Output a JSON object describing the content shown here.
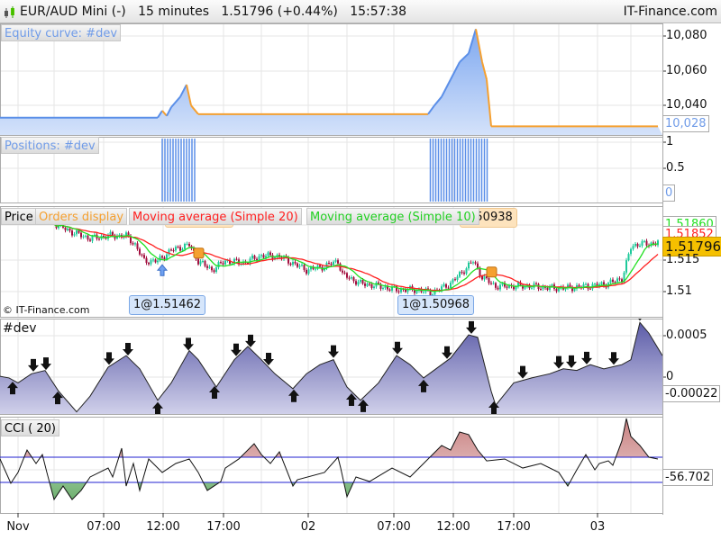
{
  "header": {
    "title": "EUR/AUD Mini (-)   15 minutes   1.51796 (+0.44%)   15:57:38",
    "brand": "IT-Finance.com"
  },
  "panels": {
    "equity": {
      "label": "Equity curve: #dev",
      "axis": [
        "10,080",
        "10,060",
        "10,040"
      ],
      "current": "10,028"
    },
    "positions": {
      "label": "Positions: #dev",
      "axis": [
        "1",
        "0.5"
      ],
      "current": "0"
    },
    "price": {
      "legend": [
        "Price",
        "Orders display",
        "Moving average (Simple 20)",
        "Moving average (Simple 10)"
      ],
      "axis": [
        "1.515",
        "1.51"
      ],
      "ma10_value": "1.51860",
      "ma20_value": "1.51852",
      "current": "1.51796",
      "orders": [
        "1@1.51462",
        "1@1.50968",
        "1.50938"
      ],
      "copyright": "© IT-Finance.com"
    },
    "dev": {
      "label": "#dev",
      "axis": [
        "0.0005",
        "0"
      ],
      "current": "-0.00022"
    },
    "cci": {
      "label": "CCI ( 20)",
      "current": "-56.702"
    }
  },
  "xaxis": {
    "ticks": [
      "Nov",
      "07:00",
      "12:00",
      "17:00",
      "02",
      "07:00",
      "12:00",
      "17:00",
      "03"
    ]
  },
  "colors": {
    "up": "#1ec99a",
    "down": "#a3103f",
    "ma20": "#ff2020",
    "ma10": "#22e022",
    "equity_up": "#5b8fe8",
    "equity_down": "#f5a030",
    "current": "#f5c000"
  },
  "chart_data": [
    {
      "type": "area",
      "name": "equity",
      "points": [
        [
          0,
          10033
        ],
        [
          70,
          10033
        ],
        [
          72,
          10037
        ],
        [
          74,
          10034
        ],
        [
          76,
          10039
        ],
        [
          80,
          10045
        ],
        [
          82.8,
          10052
        ],
        [
          84.8,
          10040
        ],
        [
          88,
          10035
        ],
        [
          190,
          10035
        ],
        [
          192.8,
          10040
        ],
        [
          196,
          10045
        ],
        [
          200,
          10055
        ],
        [
          204,
          10065
        ],
        [
          208,
          10070
        ],
        [
          211.2,
          10084
        ],
        [
          214,
          10065
        ],
        [
          216,
          10055
        ],
        [
          218,
          10028
        ],
        [
          292,
          10028
        ]
      ]
    },
    {
      "type": "bar",
      "name": "positions",
      "ranges": [
        [
          72,
          87
        ],
        [
          191,
          217
        ]
      ],
      "value": 1
    },
    {
      "type": "candlestick",
      "name": "price",
      "closes": [
        [
          24,
          1.52086
        ],
        [
          32,
          1.51943
        ],
        [
          40,
          1.51843
        ],
        [
          48,
          1.51886
        ],
        [
          56,
          1.51886
        ],
        [
          60,
          1.51743
        ],
        [
          64,
          1.51486
        ],
        [
          70,
          1.51486
        ],
        [
          76,
          1.51657
        ],
        [
          84,
          1.51743
        ],
        [
          88,
          1.51486
        ],
        [
          94,
          1.51343
        ],
        [
          100,
          1.51486
        ],
        [
          108,
          1.51457
        ],
        [
          116,
          1.51571
        ],
        [
          124,
          1.51557
        ],
        [
          128,
          1.51486
        ],
        [
          136,
          1.51343
        ],
        [
          144,
          1.514
        ],
        [
          150,
          1.51486
        ],
        [
          152,
          1.51271
        ],
        [
          160,
          1.51129
        ],
        [
          168,
          1.51086
        ],
        [
          176,
          1.51029
        ],
        [
          184,
          1.51029
        ],
        [
          192,
          1.50986
        ],
        [
          200,
          1.51129
        ],
        [
          206,
          1.51343
        ],
        [
          210,
          1.51486
        ],
        [
          214,
          1.51229
        ],
        [
          220,
          1.51086
        ],
        [
          228,
          1.51086
        ],
        [
          236,
          1.51086
        ],
        [
          244,
          1.51057
        ],
        [
          252,
          1.51057
        ],
        [
          260,
          1.51086
        ],
        [
          268,
          1.51114
        ],
        [
          276,
          1.512
        ],
        [
          280,
          1.517
        ],
        [
          284,
          1.51771
        ],
        [
          288,
          1.51743
        ],
        [
          292,
          1.518
        ]
      ],
      "buy": [
        72
      ],
      "orders": [
        88,
        218
      ]
    },
    {
      "type": "area",
      "name": "dev",
      "points": [
        [
          0,
          1e-05
        ],
        [
          4,
          -1e-05
        ],
        [
          8,
          -7e-05
        ],
        [
          14,
          4e-05
        ],
        [
          20,
          8e-05
        ],
        [
          26,
          -0.00017
        ],
        [
          34,
          -0.00042
        ],
        [
          40,
          -0.00023
        ],
        [
          48,
          0.00012
        ],
        [
          56,
          0.00026
        ],
        [
          62,
          0.0001
        ],
        [
          70,
          -0.00028
        ],
        [
          76,
          -7e-05
        ],
        [
          84,
          0.00032
        ],
        [
          88,
          0.00021
        ],
        [
          96,
          -0.00012
        ],
        [
          104,
          0.00021
        ],
        [
          110,
          0.00037
        ],
        [
          116,
          0.00021
        ],
        [
          122,
          4e-05
        ],
        [
          130,
          -0.00014
        ],
        [
          136,
          4e-05
        ],
        [
          142,
          0.00015
        ],
        [
          148,
          0.00021
        ],
        [
          154,
          -0.00012
        ],
        [
          160,
          -0.00028
        ],
        [
          168,
          -7e-05
        ],
        [
          176,
          0.00026
        ],
        [
          182,
          0.00015
        ],
        [
          188,
          -1e-05
        ],
        [
          196,
          0.00015
        ],
        [
          200,
          0.00023
        ],
        [
          208,
          0.00051
        ],
        [
          212,
          0.00048
        ],
        [
          218,
          -0.00017
        ],
        [
          220,
          -0.00034
        ],
        [
          228,
          -7e-05
        ],
        [
          236,
          -1e-05
        ],
        [
          244,
          4e-05
        ],
        [
          250,
          0.0001
        ],
        [
          256,
          8e-05
        ],
        [
          262,
          0.00015
        ],
        [
          268,
          0.0001
        ],
        [
          276,
          0.00015
        ],
        [
          280,
          0.00021
        ],
        [
          284,
          0.00066
        ],
        [
          288,
          0.00053
        ],
        [
          294,
          0.00026
        ]
      ],
      "sell_signals": [
        14.8,
        20.4,
        48.4,
        56.8,
        83.6,
        104.8,
        111.2,
        119.2,
        148,
        176.4,
        198.4,
        209.2,
        232,
        248,
        253.6,
        260.4,
        272.4,
        284
      ],
      "buy_signals": [
        5.6,
        25.6,
        70,
        95.2,
        130.4,
        156,
        161.2,
        188,
        219.2
      ]
    },
    {
      "type": "line",
      "name": "cci",
      "levels": [
        100,
        -100
      ],
      "points": [
        [
          0,
          86
        ],
        [
          4.8,
          -107
        ],
        [
          8,
          -21
        ],
        [
          12,
          157
        ],
        [
          16,
          50
        ],
        [
          18.8,
          121
        ],
        [
          20.8,
          -21
        ],
        [
          24,
          -236
        ],
        [
          28,
          -129
        ],
        [
          32,
          -236
        ],
        [
          36,
          -164
        ],
        [
          40,
          -57
        ],
        [
          48,
          14
        ],
        [
          50,
          -57
        ],
        [
          54,
          171
        ],
        [
          56,
          -129
        ],
        [
          59.2,
          50
        ],
        [
          62,
          -164
        ],
        [
          66,
          86
        ],
        [
          72,
          -21
        ],
        [
          78,
          50
        ],
        [
          84,
          86
        ],
        [
          88,
          -21
        ],
        [
          92,
          -164
        ],
        [
          98,
          -93
        ],
        [
          100,
          14
        ],
        [
          106,
          86
        ],
        [
          112.8,
          207
        ],
        [
          116,
          121
        ],
        [
          120,
          50
        ],
        [
          124,
          143
        ],
        [
          130,
          -129
        ],
        [
          132,
          -79
        ],
        [
          144,
          -21
        ],
        [
          150,
          100
        ],
        [
          151.2,
          14
        ],
        [
          154,
          -214
        ],
        [
          158,
          -57
        ],
        [
          164,
          -93
        ],
        [
          174,
          14
        ],
        [
          182,
          -57
        ],
        [
          188,
          50
        ],
        [
          196,
          193
        ],
        [
          200,
          157
        ],
        [
          204,
          300
        ],
        [
          208,
          279
        ],
        [
          212,
          157
        ],
        [
          216,
          71
        ],
        [
          224,
          86
        ],
        [
          232,
          14
        ],
        [
          240,
          50
        ],
        [
          248,
          -21
        ],
        [
          252,
          -129
        ],
        [
          256,
          0
        ],
        [
          260,
          121
        ],
        [
          264,
          0
        ],
        [
          266,
          50
        ],
        [
          270,
          71
        ],
        [
          272,
          36
        ],
        [
          276,
          229
        ],
        [
          278,
          407
        ],
        [
          280,
          264
        ],
        [
          284,
          193
        ],
        [
          288,
          100
        ],
        [
          292,
          86
        ]
      ]
    }
  ]
}
